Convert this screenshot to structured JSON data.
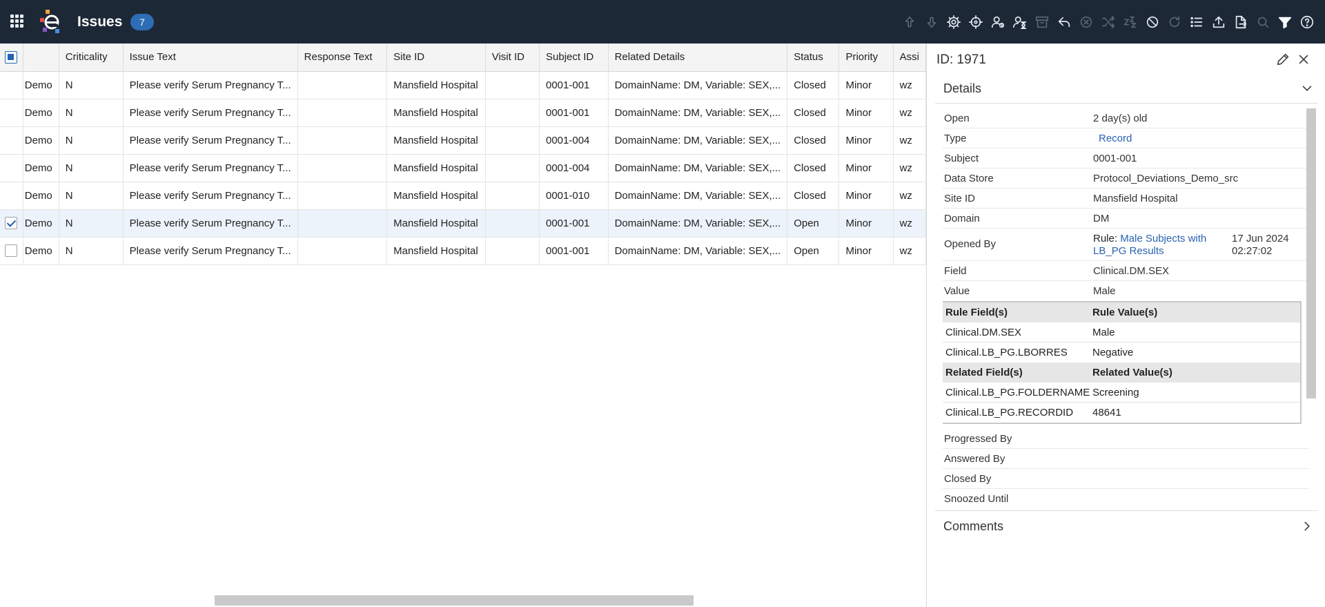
{
  "header": {
    "app_title": "Issues",
    "issue_count": "7",
    "toolbar_icons": [
      {
        "name": "move-up-icon",
        "enabled": false
      },
      {
        "name": "move-down-icon",
        "enabled": false
      },
      {
        "name": "settings-icon",
        "enabled": true
      },
      {
        "name": "crosshair-icon",
        "enabled": true
      },
      {
        "name": "assign-user-icon",
        "enabled": true
      },
      {
        "name": "progress-hourglass-icon",
        "enabled": true
      },
      {
        "name": "archive-box-icon",
        "enabled": false
      },
      {
        "name": "reply-icon",
        "enabled": true
      },
      {
        "name": "cancel-circle-icon",
        "enabled": false
      },
      {
        "name": "shuffle-icon",
        "enabled": false
      },
      {
        "name": "snooze-icon",
        "enabled": false
      },
      {
        "name": "block-icon",
        "enabled": true
      },
      {
        "name": "refresh-icon",
        "enabled": false
      },
      {
        "name": "list-icon",
        "enabled": true
      },
      {
        "name": "upload-icon",
        "enabled": true
      },
      {
        "name": "export-icon",
        "enabled": true
      },
      {
        "name": "search-icon",
        "enabled": false
      },
      {
        "name": "filter-icon",
        "enabled": true
      },
      {
        "name": "help-icon",
        "enabled": true
      }
    ]
  },
  "grid": {
    "columns": [
      "",
      "",
      "Criticality",
      "Issue Text",
      "Response Text",
      "Site ID",
      "Visit ID",
      "Subject ID",
      "Related Details",
      "Status",
      "Priority",
      "Assi"
    ],
    "rows": [
      {
        "checked": false,
        "protocol": "Demo",
        "criticality": "N",
        "issue_text": "Please verify Serum Pregnancy T...",
        "response_text": "",
        "site_id": "Mansfield Hospital",
        "visit_id": "",
        "subject_id": "0001-001",
        "related_details": "DomainName: DM, Variable: SEX,...",
        "status": "Closed",
        "priority": "Minor",
        "assignee": "wz"
      },
      {
        "checked": false,
        "protocol": "Demo",
        "criticality": "N",
        "issue_text": "Please verify Serum Pregnancy T...",
        "response_text": "",
        "site_id": "Mansfield Hospital",
        "visit_id": "",
        "subject_id": "0001-001",
        "related_details": "DomainName: DM, Variable: SEX,...",
        "status": "Closed",
        "priority": "Minor",
        "assignee": "wz"
      },
      {
        "checked": false,
        "protocol": "Demo",
        "criticality": "N",
        "issue_text": "Please verify Serum Pregnancy T...",
        "response_text": "",
        "site_id": "Mansfield Hospital",
        "visit_id": "",
        "subject_id": "0001-004",
        "related_details": "DomainName: DM, Variable: SEX,...",
        "status": "Closed",
        "priority": "Minor",
        "assignee": "wz"
      },
      {
        "checked": false,
        "protocol": "Demo",
        "criticality": "N",
        "issue_text": "Please verify Serum Pregnancy T...",
        "response_text": "",
        "site_id": "Mansfield Hospital",
        "visit_id": "",
        "subject_id": "0001-004",
        "related_details": "DomainName: DM, Variable: SEX,...",
        "status": "Closed",
        "priority": "Minor",
        "assignee": "wz"
      },
      {
        "checked": false,
        "protocol": "Demo",
        "criticality": "N",
        "issue_text": "Please verify Serum Pregnancy T...",
        "response_text": "",
        "site_id": "Mansfield Hospital",
        "visit_id": "",
        "subject_id": "0001-010",
        "related_details": "DomainName: DM, Variable: SEX,...",
        "status": "Closed",
        "priority": "Minor",
        "assignee": "wz"
      },
      {
        "checked": true,
        "protocol": "Demo",
        "criticality": "N",
        "issue_text": "Please verify Serum Pregnancy T...",
        "response_text": "",
        "site_id": "Mansfield Hospital",
        "visit_id": "",
        "subject_id": "0001-001",
        "related_details": "DomainName: DM, Variable: SEX,...",
        "status": "Open",
        "priority": "Minor",
        "assignee": "wz"
      },
      {
        "checked": false,
        "protocol": "Demo",
        "criticality": "N",
        "issue_text": "Please verify Serum Pregnancy T...",
        "response_text": "",
        "site_id": "Mansfield Hospital",
        "visit_id": "",
        "subject_id": "0001-001",
        "related_details": "DomainName: DM, Variable: SEX,...",
        "status": "Open",
        "priority": "Minor",
        "assignee": "wz"
      }
    ]
  },
  "panel": {
    "id_label": "ID: 1971",
    "details_label": "Details",
    "comments_label": "Comments",
    "fields": {
      "open": {
        "key": "Open",
        "value": "2 day(s) old"
      },
      "type": {
        "key": "Type",
        "value": "Record"
      },
      "subject": {
        "key": "Subject",
        "value": "0001-001"
      },
      "data_store": {
        "key": "Data Store",
        "value": "Protocol_Deviations_Demo_src"
      },
      "site_id": {
        "key": "Site ID",
        "value": "Mansfield Hospital"
      },
      "domain": {
        "key": "Domain",
        "value": "DM"
      },
      "opened_by": {
        "key": "Opened By",
        "prefix": "Rule: ",
        "rule_name": "Male Subjects with LB_PG Results",
        "date": "17 Jun 2024 02:27:02"
      },
      "field": {
        "key": "Field",
        "value": "Clinical.DM.SEX"
      },
      "value": {
        "key": "Value",
        "value": "Male"
      }
    },
    "rule_table": {
      "header": [
        "Rule Field(s)",
        "Rule Value(s)"
      ],
      "rows": [
        [
          "Clinical.DM.SEX",
          "Male"
        ],
        [
          "Clinical.LB_PG.LBORRES",
          "Negative"
        ]
      ],
      "related_header": [
        "Related Field(s)",
        "Related Value(s)"
      ],
      "related_rows": [
        [
          "Clinical.LB_PG.FOLDERNAME",
          "Screening"
        ],
        [
          "Clinical.LB_PG.RECORDID",
          "48641"
        ]
      ]
    },
    "more_fields": {
      "progressed_by": "Progressed By",
      "answered_by": "Answered By",
      "closed_by": "Closed By",
      "snoozed_until": "Snoozed Until"
    }
  }
}
